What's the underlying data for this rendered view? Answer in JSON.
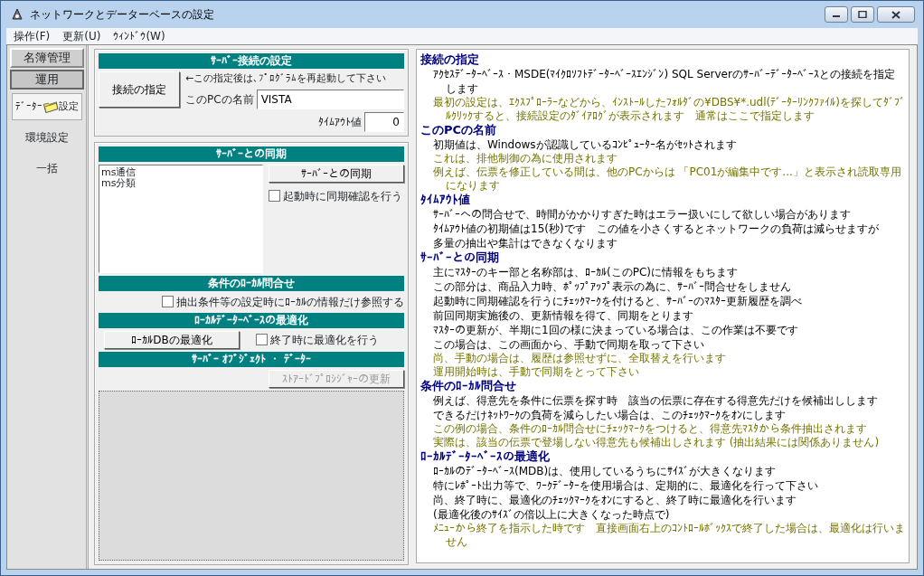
{
  "window": {
    "title": "ネットワークとデーターベースの設定"
  },
  "menu": [
    {
      "label": "操作(F)"
    },
    {
      "label": "更新(U)"
    },
    {
      "label": "ｳｨﾝﾄﾞｳ(W)"
    }
  ],
  "sidebar": {
    "items": [
      {
        "kind": "group",
        "label": "名簿管理",
        "selected": false
      },
      {
        "kind": "group",
        "label": "運用",
        "selected": true
      },
      {
        "kind": "item",
        "label": "ﾃﾞｰﾀｰ",
        "label_after": "設定",
        "selected": true
      },
      {
        "kind": "item",
        "label": "環境設定",
        "selected": false
      },
      {
        "kind": "item",
        "label": "一括",
        "selected": false
      }
    ]
  },
  "connection": {
    "title": "ｻｰﾊﾞｰ接続の設定",
    "button": "接続の指定",
    "note": "←この指定後は､ﾌﾟﾛｸﾞﾗﾑを再起動して下さい",
    "pc_name": {
      "label": "このPCの名前",
      "value": "VISTA"
    },
    "timeout": {
      "label": "ﾀｲﾑｱｳﾄ値",
      "value": "0"
    }
  },
  "sync": {
    "title": "ｻｰﾊﾞｰとの同期",
    "list": [
      "ms通信",
      "ms分類"
    ],
    "button": "ｻｰﾊﾞｰとの同期",
    "checkbox": {
      "label": "起動時に同期確認を行う",
      "checked": false
    }
  },
  "local_query": {
    "title": "条件のﾛｰｶﾙ問合せ",
    "checkbox": {
      "label": "抽出条件等の設定時にﾛｰｶﾙの情報だけ参照する",
      "checked": false
    }
  },
  "optimize": {
    "title": "ﾛｰｶﾙﾃﾞｰﾀｰﾍﾞｰｽの最適化",
    "button": "ﾛｰｶﾙDBの最適化",
    "checkbox": {
      "label": "終了時に最適化を行う",
      "checked": false
    }
  },
  "server_objects": {
    "title": "ｻｰﾊﾞｰ ｵﾌﾞｼﾞｪｸﾄ ・ ﾃﾞｰﾀｰ",
    "button": {
      "label": "ｽﾄｱｰﾄﾞﾌﾟﾛｼｼﾞｬｰの更新",
      "disabled": true
    }
  },
  "help": [
    {
      "heading": "接続の指定",
      "lines": [
        {
          "kind": "normal",
          "text": "ｱｸｾｽﾃﾞｰﾀｰﾍﾞｰｽ・MSDE(ﾏｲｸﾛｿﾌﾄﾃﾞｰﾀｰﾍﾞｰｽｴﾝｼﾞﾝ) SQL Serverのｻｰﾊﾞｰﾃﾞｰﾀｰﾍﾞｰｽとの接続を指定します"
        },
        {
          "kind": "note",
          "text": "最初の設定は、ｴｸｽﾌﾟﾛｰﾗｰなどから、ｲﾝｽﾄｰﾙしたﾌｫﾙﾀﾞの¥DBS¥*.udl(ﾃﾞｰﾀｰﾘﾝｸﾌｧｲﾙ)を探してﾀﾞﾌﾞﾙｸﾘｯｸすると、接続設定のﾀﾞｲｱﾛｸﾞが表示されます　通常はここで指定します"
        }
      ]
    },
    {
      "heading": "このPCの名前",
      "lines": [
        {
          "kind": "normal",
          "text": "初期値は、Windowsが認識しているｺﾝﾋﾟｭｰﾀｰ名がｾｯﾄされます"
        },
        {
          "kind": "note",
          "text": "これは、排他制御の為に使用されます"
        },
        {
          "kind": "note",
          "text": "例えば、伝票を修正している間は、他のPCからは 「PC01が編集中です...」と表示され読取専用になります"
        }
      ]
    },
    {
      "heading": "ﾀｲﾑｱｳﾄ値",
      "lines": [
        {
          "kind": "normal",
          "text": "ｻｰﾊﾞｰへの問合せで、時間がかかりすぎた時はエラー扱いにして欲しい場合があります"
        },
        {
          "kind": "normal",
          "text": "ﾀｲﾑｱｳﾄ値の初期値は15(秒)です　この値を小さくするとネットワークの負荷は減らせますが"
        },
        {
          "kind": "normal",
          "text": "多量の抽出や集計はできなくなります"
        }
      ]
    },
    {
      "heading": "ｻｰﾊﾞｰとの同期",
      "lines": [
        {
          "kind": "normal",
          "text": "主にﾏｽﾀｰのキー部と名称部は、ﾛｰｶﾙ(このPC)に情報をもちます"
        },
        {
          "kind": "normal",
          "text": "この部分は、商品入力時、ﾎﾟｯﾌﾟｱｯﾌﾟ表示の為に、ｻｰﾊﾞｰ問合せをしません"
        },
        {
          "kind": "normal",
          "text": "起動時に同期確認を行うにﾁｪｯｸﾏｰｸを付けると、ｻｰﾊﾞｰのﾏｽﾀｰ更新履歴を調べ"
        },
        {
          "kind": "normal",
          "text": "前回同期実施後の、更新情報を得て、同期をとります"
        },
        {
          "kind": "normal",
          "text": "ﾏｽﾀｰの更新が、半期に1回の様に決まっている場合は、この作業は不要です"
        },
        {
          "kind": "normal",
          "text": "この場合は、この画面から、手動で同期を取って下さい"
        },
        {
          "kind": "note",
          "text": "尚、手動の場合は、履歴は参照せずに、全取替えを行います"
        },
        {
          "kind": "note",
          "text": "運用開始時は、手動で同期をとって下さい"
        }
      ]
    },
    {
      "heading": "条件のﾛｰｶﾙ問合せ",
      "lines": [
        {
          "kind": "normal",
          "text": "例えば、得意先を条件に伝票を探す時　該当の伝票に存在する得意先だけを候補出しします"
        },
        {
          "kind": "normal",
          "text": "できるだけﾈｯﾄﾜｰｸの負荷を減らしたい場合は、このﾁｪｯｸﾏｰｸをｵﾝにします"
        },
        {
          "kind": "note",
          "text": "この例の場合、条件のﾛｰｶﾙ問合せにﾁｪｯｸﾏｰｸをつけると、得意先ﾏｽﾀから条件抽出されます"
        },
        {
          "kind": "note",
          "text": "実際は、該当の伝票で登場しない得意先も候補出しされます (抽出結果には関係ありません)"
        }
      ]
    },
    {
      "heading": "ﾛｰｶﾙﾃﾞｰﾀｰﾍﾞｰｽの最適化",
      "lines": [
        {
          "kind": "normal",
          "text": "ﾛｰｶﾙのﾃﾞｰﾀｰﾍﾞｰｽ(MDB)は、使用しているうちにｻｲｽﾞが大きくなります"
        },
        {
          "kind": "normal",
          "text": "特にﾚﾎﾟｰﾄ出力等で、ﾜｰｸﾃﾞｰﾀｰを使用場合は、定期的に、最適化を行って下さい"
        },
        {
          "kind": "normal",
          "text": "尚、終了時に、最適化のﾁｪｯｸﾏｰｸをｵﾝにすると、終了時に最適化を行います"
        },
        {
          "kind": "normal",
          "text": "(最適化後のｻｲｽﾞの倍以上に大きくなった時点で)"
        },
        {
          "kind": "note",
          "text": "ﾒﾆｭｰから終了を指示した時です　直接画面右上のｺﾝﾄﾛｰﾙﾎﾞｯｸｽで終了した場合は、最適化は行いません"
        }
      ]
    }
  ]
}
